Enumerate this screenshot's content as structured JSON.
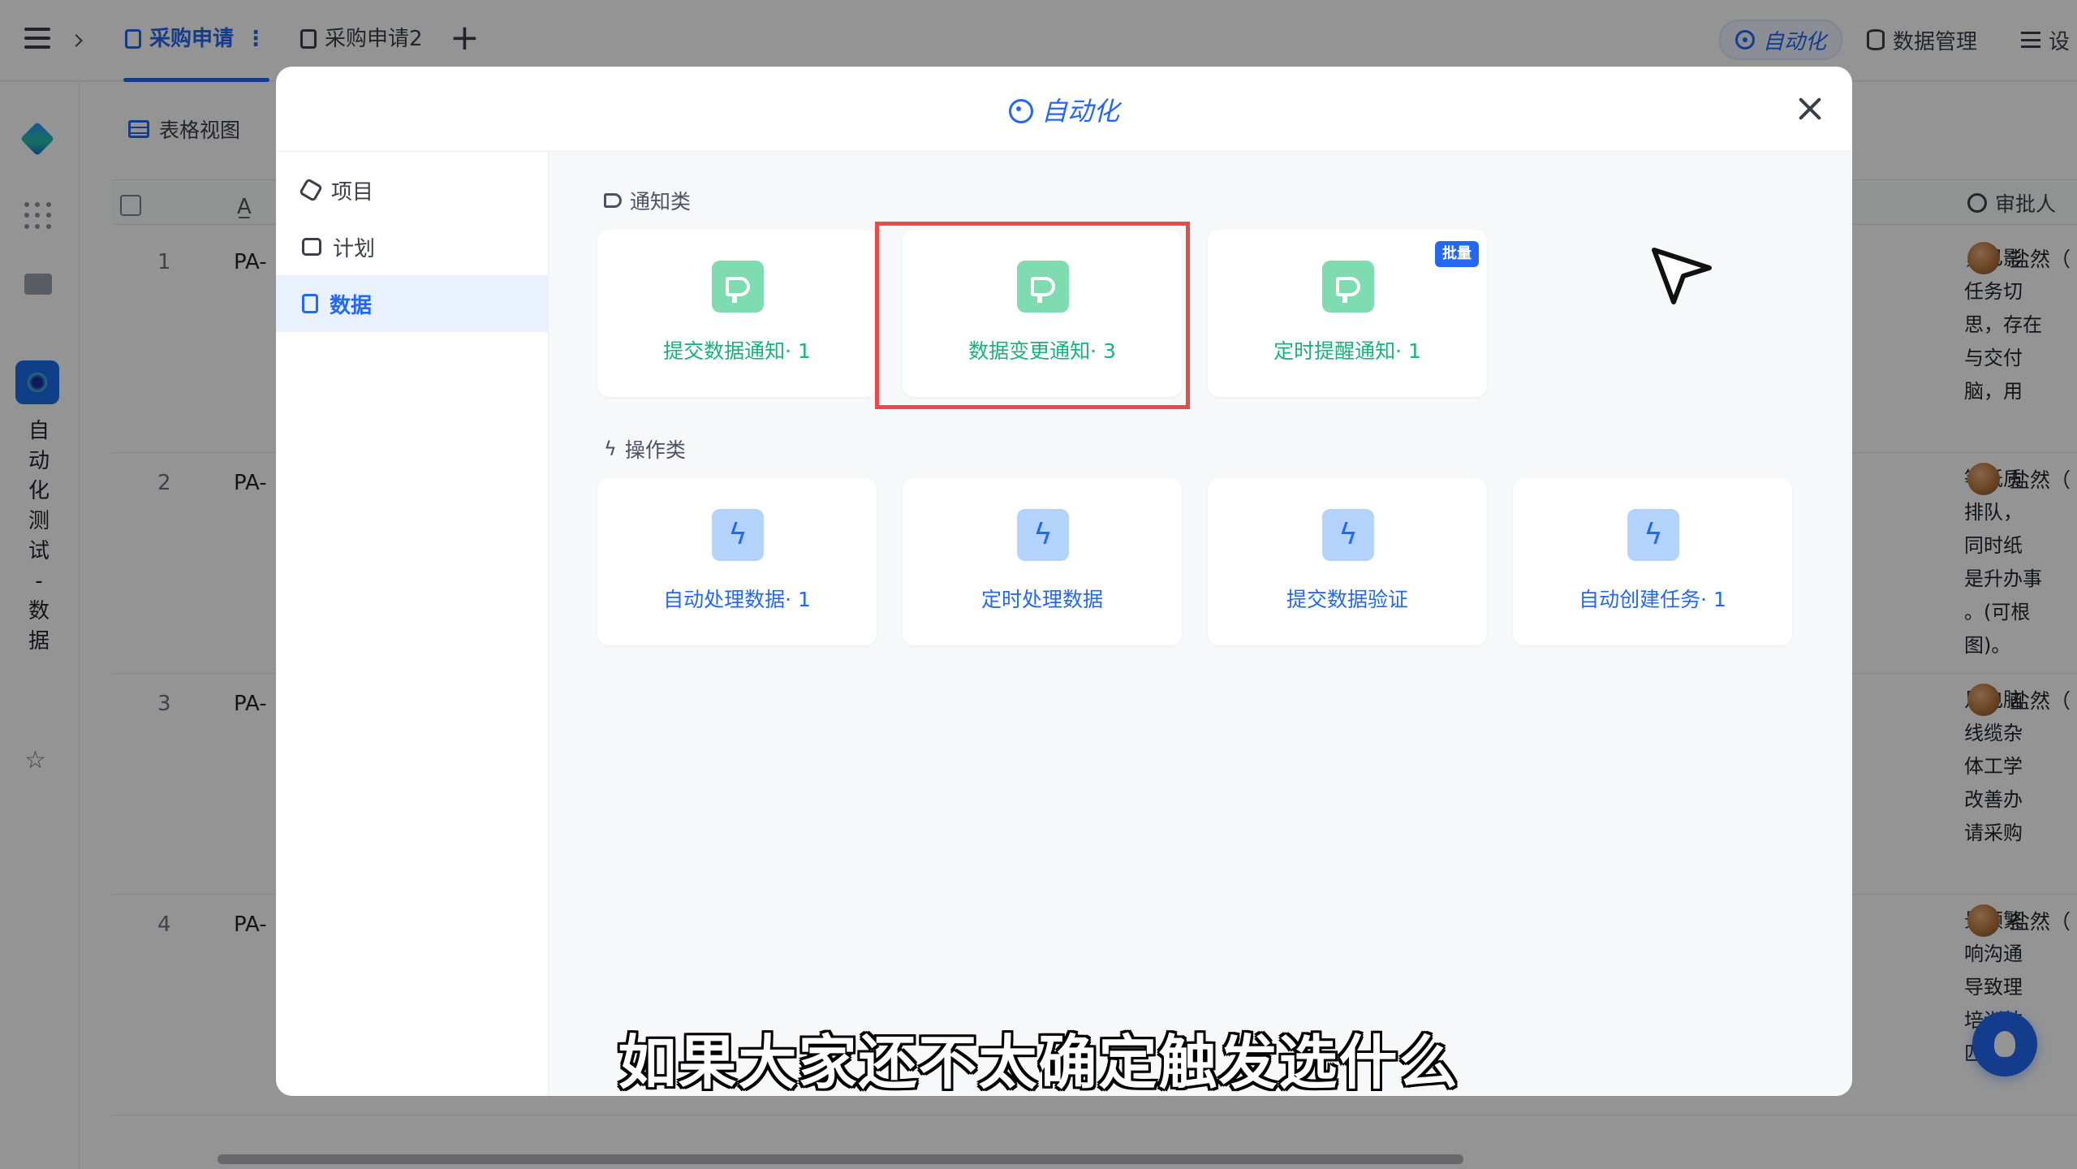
{
  "topbar": {
    "tabs": [
      {
        "label": "采购申请",
        "active": true
      },
      {
        "label": "采购申请2",
        "active": false
      }
    ],
    "add_tab": "+",
    "more": "⋮",
    "right": {
      "automation": "自动化",
      "data_manage": "数据管理",
      "settings": "设"
    }
  },
  "sidebar": {
    "app_title": [
      "自",
      "动",
      "化",
      "测",
      "试",
      "-",
      "数",
      "据"
    ],
    "star": "☆"
  },
  "table": {
    "view_label": "表格视图",
    "approver_header": "审批人",
    "rows": [
      {
        "num": "1",
        "code": "PA-",
        "desc": [
          "，已影",
          "任务切",
          "思，存在",
          "与交付",
          "脑，用"
        ],
        "approver": "盐然（"
      },
      {
        "num": "2",
        "code": "PA-",
        "desc": [
          "等纸质",
          "排队，",
          "同时纸",
          "是升办事",
          "。(可根",
          "图)。"
        ],
        "approver": "盐然（"
      },
      {
        "num": "3",
        "code": "PA-",
        "desc": [
          "足电脑",
          "线缆杂",
          "体工学",
          "改善办",
          "请采购"
        ],
        "approver": "盐然（"
      },
      {
        "num": "4",
        "code": "PA-",
        "desc": [
          "景频繁",
          "响沟通",
          "导致理",
          "培训效",
          "匹配亮"
        ],
        "approver": "盐然（"
      }
    ]
  },
  "modal": {
    "title": "自动化",
    "side_items": [
      {
        "label": "项目",
        "active": false
      },
      {
        "label": "计划",
        "active": false
      },
      {
        "label": "数据",
        "active": true
      }
    ],
    "sections": {
      "notify": "通知类",
      "action": "操作类"
    },
    "notify_cards": [
      {
        "label": "提交数据通知· 1",
        "badge": ""
      },
      {
        "label": "数据变更通知· 3",
        "badge": ""
      },
      {
        "label": "定时提醒通知· 1",
        "badge": "批量"
      }
    ],
    "action_cards": [
      {
        "label": "自动处理数据· 1"
      },
      {
        "label": "定时处理数据"
      },
      {
        "label": "提交数据验证"
      },
      {
        "label": "自动创建任务· 1"
      }
    ]
  },
  "subtitle": "如果大家还不太确定触发选什么",
  "colors": {
    "primary": "#2468f2",
    "green": "#1ab27a",
    "highlight": "#ea4b48"
  }
}
